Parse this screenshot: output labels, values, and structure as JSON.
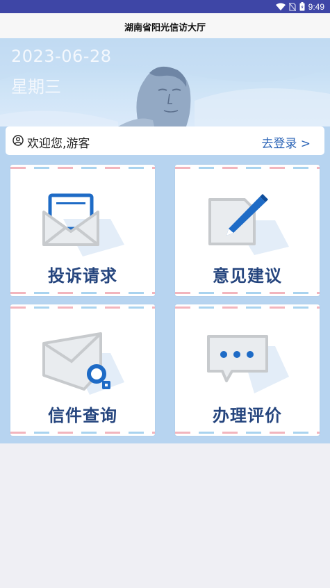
{
  "status_bar": {
    "time": "9:49"
  },
  "header": {
    "title": "湖南省阳光信访大厅"
  },
  "banner": {
    "date": "2023-06-28",
    "weekday": "星期三"
  },
  "welcome": {
    "greeting": "欢迎您,游客",
    "login_link": "去登录 >"
  },
  "menu": [
    {
      "label": "投诉请求",
      "icon": "envelope-letter-icon"
    },
    {
      "label": "意见建议",
      "icon": "document-pen-icon"
    },
    {
      "label": "信件查询",
      "icon": "envelope-search-icon"
    },
    {
      "label": "办理评价",
      "icon": "chat-bubble-icon"
    }
  ],
  "colors": {
    "status_bar": "#3e46a6",
    "card_label": "#25457e",
    "accent_blue": "#1e6bc6",
    "background": "#b7d4f0"
  }
}
